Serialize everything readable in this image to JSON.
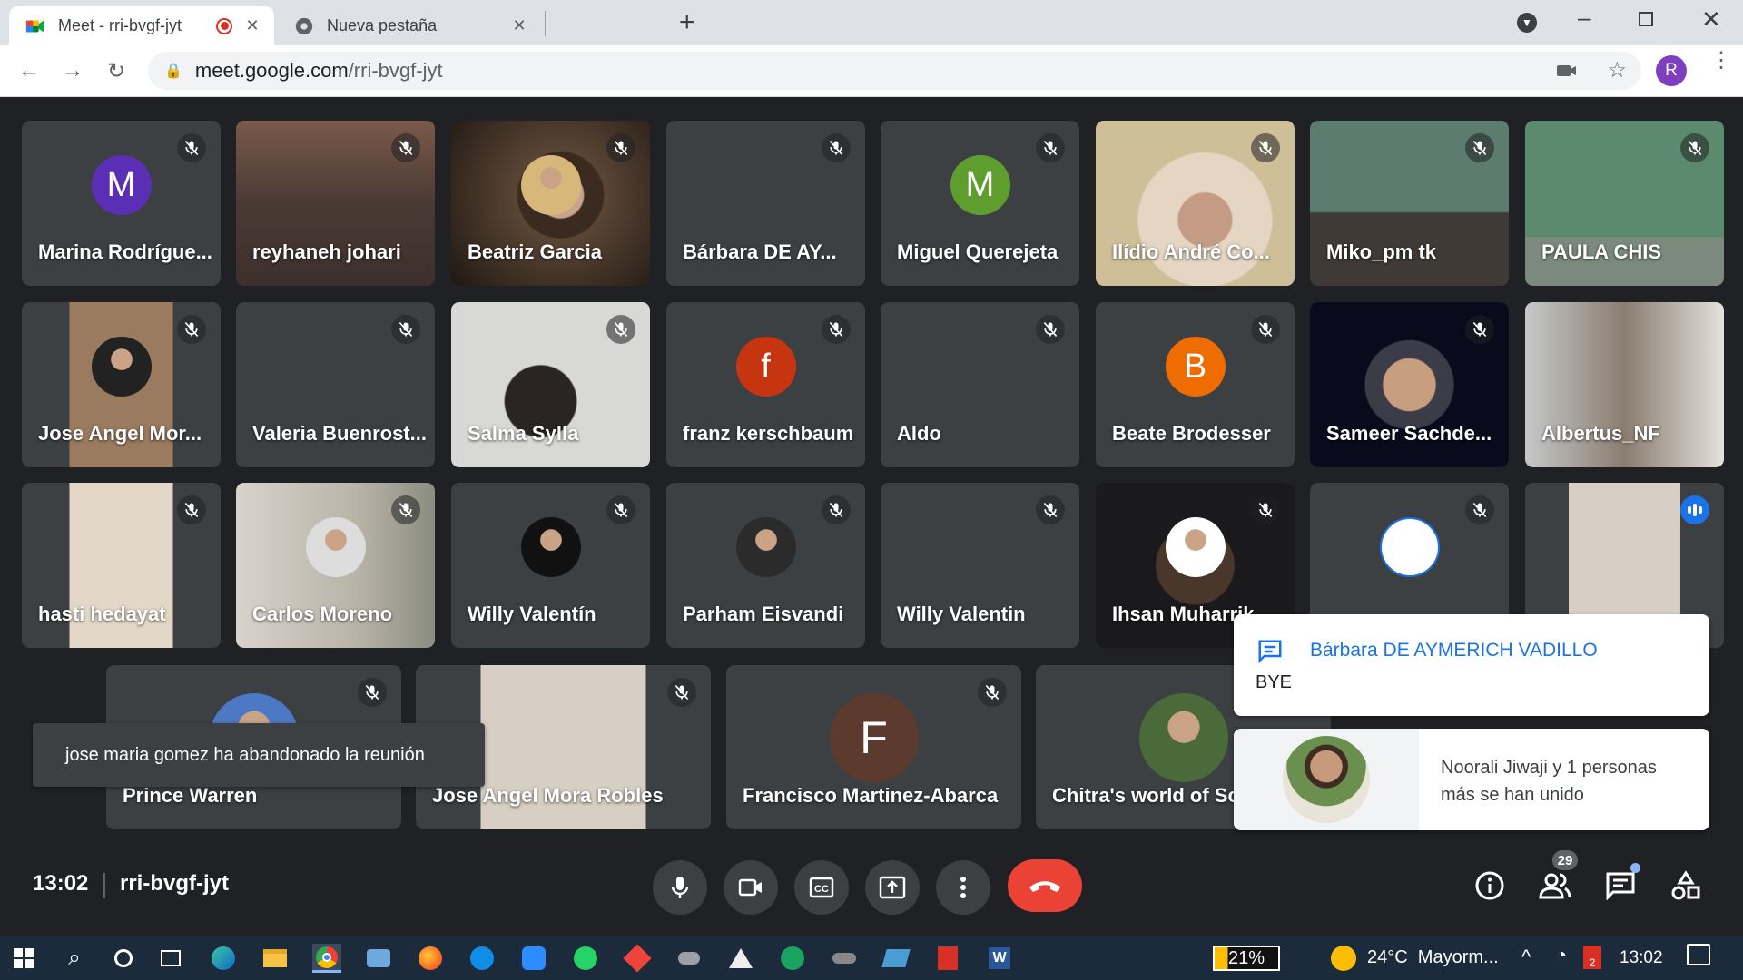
{
  "browser": {
    "tabs": [
      {
        "title": "Meet - rri-bvgf-jyt",
        "recording": true
      },
      {
        "title": "Nueva pestaña"
      }
    ],
    "url_host": "meet.google.com",
    "url_path": "/rri-bvgf-jyt",
    "profile_initial": "R"
  },
  "participants": [
    {
      "name": "Marina Rodrígue...",
      "initial": "M",
      "avatar_color": "#5b2fb5"
    },
    {
      "name": "reyhaneh johari"
    },
    {
      "name": "Beatriz Garcia"
    },
    {
      "name": "Bárbara DE AY..."
    },
    {
      "name": "Miguel Querejeta",
      "initial": "M",
      "avatar_color": "#5f9e2e"
    },
    {
      "name": "Ilídio André Co..."
    },
    {
      "name": "Miko_pm tk"
    },
    {
      "name": "PAULA CHIS"
    },
    {
      "name": "Jose Angel Mor..."
    },
    {
      "name": "Valeria Buenrost..."
    },
    {
      "name": "Salma Sylla"
    },
    {
      "name": "franz kerschbaum",
      "initial": "f",
      "avatar_color": "#c6350f"
    },
    {
      "name": "Aldo"
    },
    {
      "name": "Beate Brodesser",
      "initial": "B",
      "avatar_color": "#ef6c00"
    },
    {
      "name": "Sameer Sachde..."
    },
    {
      "name": "Albertus_NF"
    },
    {
      "name": "hasti hedayat"
    },
    {
      "name": "Carlos Moreno"
    },
    {
      "name": "Willy Valentín"
    },
    {
      "name": "Parham Eisvandi"
    },
    {
      "name": "Willy Valentin"
    },
    {
      "name": "Ihsan Muharrik"
    },
    {
      "name": "Prince Warren"
    },
    {
      "name": "Jose Angel Mora Robles"
    },
    {
      "name": "Francisco Martinez-Abarca",
      "initial": "F",
      "avatar_color": "#5d3a2e"
    },
    {
      "name": "Chitra's world of Sci"
    }
  ],
  "toast": {
    "text": "jose maria gomez ha abandonado la reunión"
  },
  "chat_notification": {
    "sender": "Bárbara DE AYMERICH VADILLO",
    "message": "BYE"
  },
  "join_notification": {
    "text": "Noorali Jiwaji y 1 personas más se han unido"
  },
  "meeting": {
    "time": "13:02",
    "code": "rri-bvgf-jyt",
    "participant_count": "29"
  },
  "taskbar": {
    "battery": "21%",
    "weather": "24°C  Mayorm...",
    "time": "13:02",
    "notif_count": "2"
  },
  "colors": {
    "end_call": "#ea4335",
    "speaking": "#1a73e8",
    "chat_accent": "#1a73e8"
  }
}
